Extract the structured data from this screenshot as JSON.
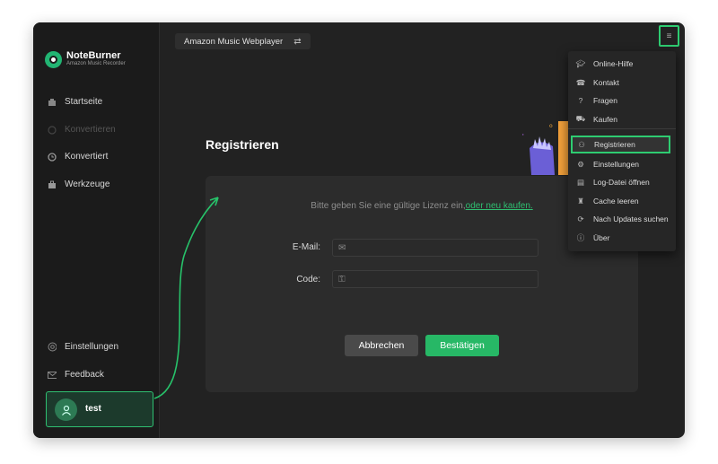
{
  "colors": {
    "accent": "#2fbf71",
    "bg": "#222222",
    "sidebar": "#1b1b1b"
  },
  "app": {
    "name": "NoteBurner",
    "subtitle": "Amazon Music Recorder"
  },
  "source_button": {
    "label": "Amazon Music Webplayer",
    "icon": "swap-icon"
  },
  "sidebar": {
    "items": [
      {
        "label": "Startseite",
        "icon": "home-icon"
      },
      {
        "label": "Konvertieren",
        "icon": "convert-icon"
      },
      {
        "label": "Konvertiert",
        "icon": "clock-icon"
      },
      {
        "label": "Werkzeuge",
        "icon": "toolbox-icon"
      }
    ],
    "bottom": [
      {
        "label": "Einstellungen",
        "icon": "gear-icon"
      },
      {
        "label": "Feedback",
        "icon": "mail-icon"
      }
    ],
    "user": {
      "name": "test",
      "icon": "user-icon"
    }
  },
  "register": {
    "title": "Registrieren",
    "hint": "Bitte geben Sie eine gültige Lizenz ein,",
    "hint_link": "oder neu kaufen.",
    "email_label": "E-Mail:",
    "code_label": "Code:",
    "cancel": "Abbrechen",
    "confirm": "Bestätigen"
  },
  "menu": {
    "items": [
      {
        "label": "Online-Hilfe",
        "icon": "graduation-cap-icon"
      },
      {
        "label": "Kontakt",
        "icon": "phone-icon"
      },
      {
        "label": "Fragen",
        "icon": "question-icon"
      },
      {
        "label": "Kaufen",
        "icon": "cart-icon"
      },
      {
        "label": "Registrieren",
        "icon": "user-key-icon"
      },
      {
        "label": "Einstellungen",
        "icon": "gear-icon"
      },
      {
        "label": "Log-Datei öffnen",
        "icon": "file-icon"
      },
      {
        "label": "Cache leeren",
        "icon": "broom-icon"
      },
      {
        "label": "Nach Updates suchen",
        "icon": "refresh-icon"
      },
      {
        "label": "Über",
        "icon": "info-icon"
      }
    ]
  }
}
